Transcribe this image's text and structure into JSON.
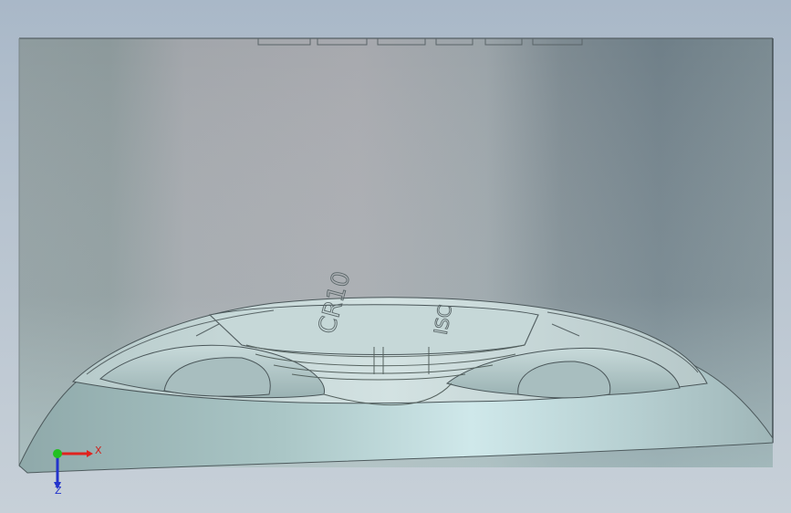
{
  "viewport": {
    "background_color": "#b4c1ce",
    "model_color": "#9fb2b4"
  },
  "model": {
    "engraving_line1": "CR10",
    "engraving_line2": "ISC"
  },
  "triad": {
    "x_label": "X",
    "z_label": "Z",
    "x_color": "#e0231e",
    "y_color": "#22c022",
    "z_color": "#2233cc"
  }
}
